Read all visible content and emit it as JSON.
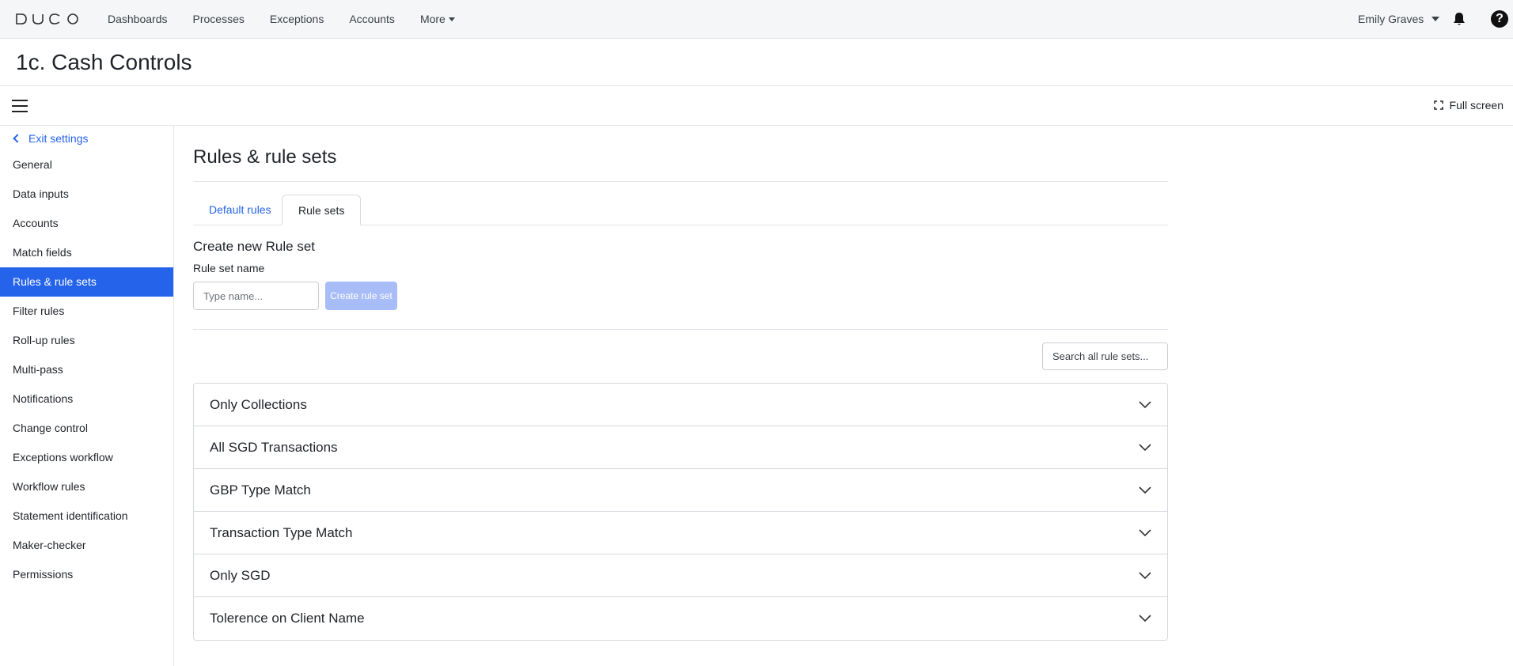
{
  "nav": {
    "logo_text": "DUCO",
    "links": [
      "Dashboards",
      "Processes",
      "Exceptions",
      "Accounts"
    ],
    "more_label": "More",
    "user_name": "Emily Graves",
    "help_label": "?"
  },
  "header": {
    "title": "1c. Cash Controls"
  },
  "toolbar": {
    "fullscreen_label": "Full screen"
  },
  "sidebar": {
    "exit_label": "Exit settings",
    "items": [
      {
        "label": "General"
      },
      {
        "label": "Data inputs"
      },
      {
        "label": "Accounts"
      },
      {
        "label": "Match fields"
      },
      {
        "label": "Rules & rule sets",
        "active": true
      },
      {
        "label": "Filter rules"
      },
      {
        "label": "Roll-up rules"
      },
      {
        "label": "Multi-pass"
      },
      {
        "label": "Notifications"
      },
      {
        "label": "Change control"
      },
      {
        "label": "Exceptions workflow"
      },
      {
        "label": "Workflow rules"
      },
      {
        "label": "Statement identification"
      },
      {
        "label": "Maker-checker"
      },
      {
        "label": "Permissions"
      }
    ]
  },
  "main": {
    "section_title": "Rules & rule sets",
    "tabs": [
      {
        "label": "Default rules",
        "active": false
      },
      {
        "label": "Rule sets",
        "active": true
      }
    ],
    "create": {
      "title": "Create new Rule set",
      "field_label": "Rule set name",
      "input_placeholder": "Type name...",
      "button_label": "Create rule set"
    },
    "search_placeholder": "Search all rule sets...",
    "rule_sets": [
      "Only Collections",
      "All SGD Transactions",
      "GBP Type Match",
      "Transaction Type Match",
      "Only SGD",
      "Tolerence on Client Name"
    ]
  },
  "colors": {
    "accent": "#2563eb",
    "disabled_button": "#a8bdf7",
    "topnav_bg": "#f5f6f8"
  }
}
